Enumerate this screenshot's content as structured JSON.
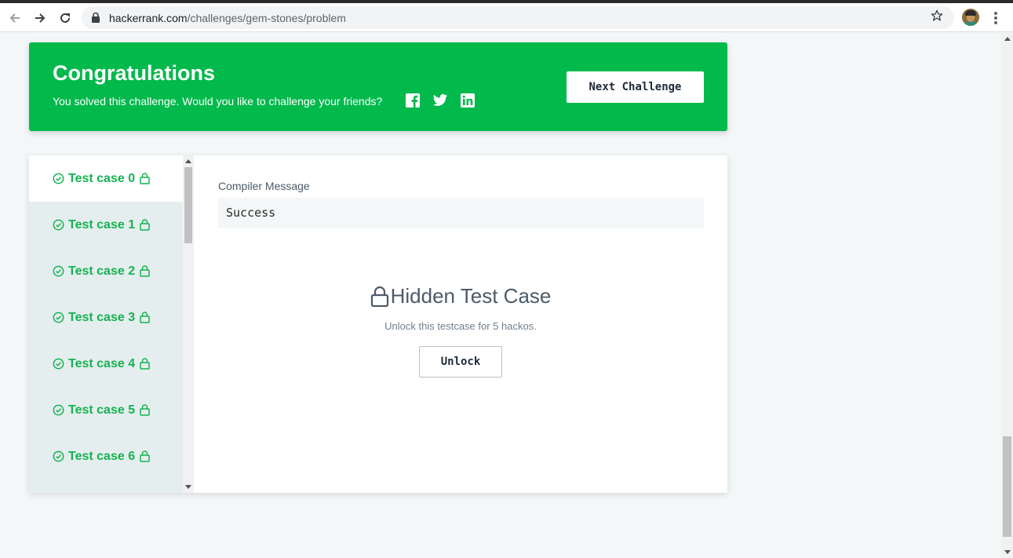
{
  "browser": {
    "url_host": "hackerrank.com",
    "url_path": "/challenges/gem-stones/problem"
  },
  "banner": {
    "title": "Congratulations",
    "subtitle": "You solved this challenge. Would you like to challenge your friends?",
    "next_button": "Next Challenge",
    "social_icons": [
      "facebook-icon",
      "twitter-icon",
      "linkedin-icon"
    ]
  },
  "test_cases": [
    {
      "label": "Test case 0",
      "status": "passed",
      "locked": true,
      "active": true
    },
    {
      "label": "Test case 1",
      "status": "passed",
      "locked": true,
      "active": false
    },
    {
      "label": "Test case 2",
      "status": "passed",
      "locked": true,
      "active": false
    },
    {
      "label": "Test case 3",
      "status": "passed",
      "locked": true,
      "active": false
    },
    {
      "label": "Test case 4",
      "status": "passed",
      "locked": true,
      "active": false
    },
    {
      "label": "Test case 5",
      "status": "passed",
      "locked": true,
      "active": false
    },
    {
      "label": "Test case 6",
      "status": "passed",
      "locked": true,
      "active": false
    }
  ],
  "result": {
    "compiler_label": "Compiler Message",
    "compiler_message": "Success",
    "hidden_title": "Hidden Test Case",
    "unlock_text": "Unlock this testcase for 5 hackos.",
    "unlock_button": "Unlock"
  },
  "colors": {
    "accent_green": "#02b94b",
    "passed_green": "#16b252",
    "page_bg": "#f3f7f7"
  }
}
